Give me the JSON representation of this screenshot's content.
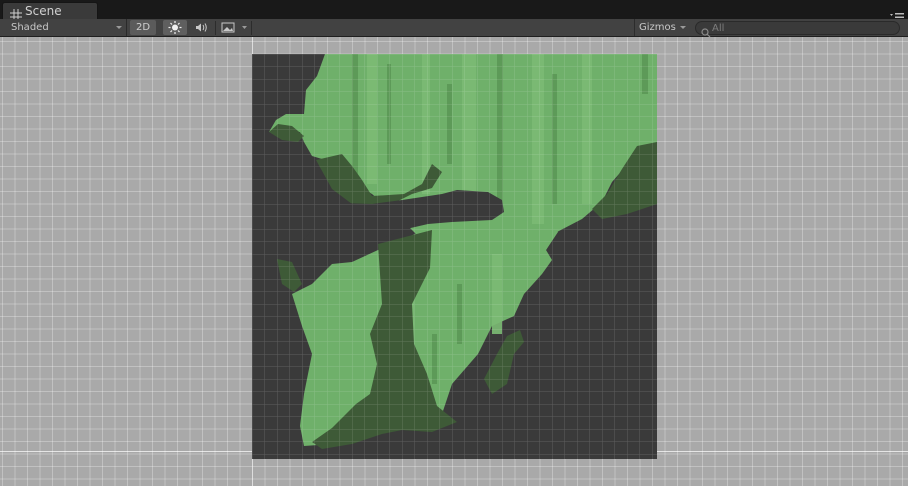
{
  "tab": {
    "title": "Scene",
    "icon": "scene-grid-icon"
  },
  "toolbar": {
    "draw_mode": "Shaded",
    "mode_2d": "2D",
    "lighting_icon": "sun-icon",
    "audio_icon": "speaker-icon",
    "effects_icon": "image-icon",
    "gizmos": "Gizmos",
    "search": {
      "value": "",
      "placeholder": "All"
    }
  },
  "colors": {
    "dark": "#3a3a3a",
    "light_green": "#6fb06a",
    "mid_green": "#5d9a58",
    "dark_green": "#3e5a37",
    "grid_bg": "#a9a9a9"
  }
}
